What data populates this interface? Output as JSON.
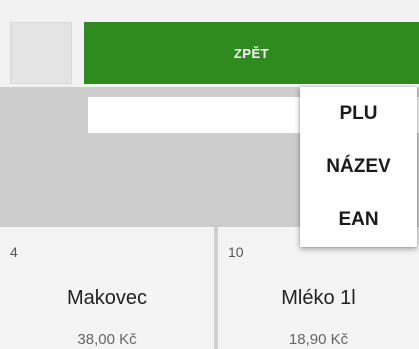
{
  "header": {
    "back_label": "ZPĚT"
  },
  "search": {
    "value": "",
    "placeholder": ""
  },
  "menu": {
    "items": [
      "PLU",
      "NÁZEV",
      "EAN"
    ]
  },
  "products": [
    {
      "plu": "4",
      "name": "Makovec",
      "price": "38,00 Kč"
    },
    {
      "plu": "10",
      "name": "Mléko 1l",
      "price": "18,90 Kč"
    }
  ]
}
